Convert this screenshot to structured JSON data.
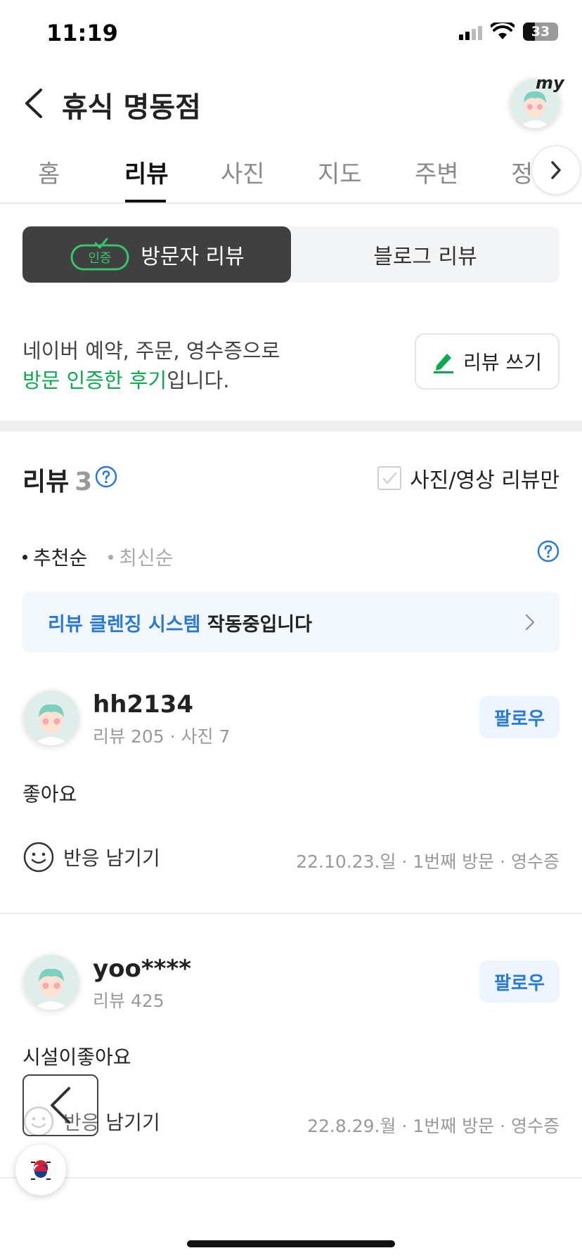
{
  "status_bar": {
    "time": "11:19",
    "battery": "33",
    "battery_level": 0.33
  },
  "header": {
    "title": "휴식 명동점",
    "my_label": "my"
  },
  "tabs": [
    {
      "label": "홈"
    },
    {
      "label": "리뷰"
    },
    {
      "label": "사진"
    },
    {
      "label": "지도"
    },
    {
      "label": "주변"
    },
    {
      "label": "정"
    }
  ],
  "segment": {
    "badge": "인증",
    "visitor_label": "방문자 리뷰",
    "blog_label": "블로그 리뷰"
  },
  "intro": {
    "line1": "네이버 예약, 주문, 영수증으로",
    "line2_highlight": "방문 인증한 후기",
    "line2_rest": "입니다.",
    "write_button": "리뷰 쓰기"
  },
  "reviews_header": {
    "title": "리뷰",
    "count": "3",
    "photo_filter": "사진/영상 리뷰만"
  },
  "sort": {
    "recommended": "추천순",
    "latest": "최신순"
  },
  "banner": {
    "highlight": "리뷰 클렌징 시스템",
    "rest": " 작동중입니다"
  },
  "reviews": [
    {
      "name": "hh2134",
      "stats": "리뷰 205 · 사진 7",
      "follow": "팔로우",
      "text": "좋아요",
      "reaction": "반응 남기기",
      "meta": "22.10.23.일 · 1번째 방문 · 영수증"
    },
    {
      "name": "yoo****",
      "stats": "리뷰 425",
      "follow": "팔로우",
      "text": "시설이좋아요",
      "reaction": "반응 남기기",
      "meta": "22.8.29.월 · 1번째 방문 · 영수증"
    }
  ],
  "colors": {
    "accent_green": "#0aaa4e",
    "accent_blue": "#2a7ad5",
    "segment_active": "#404040"
  }
}
